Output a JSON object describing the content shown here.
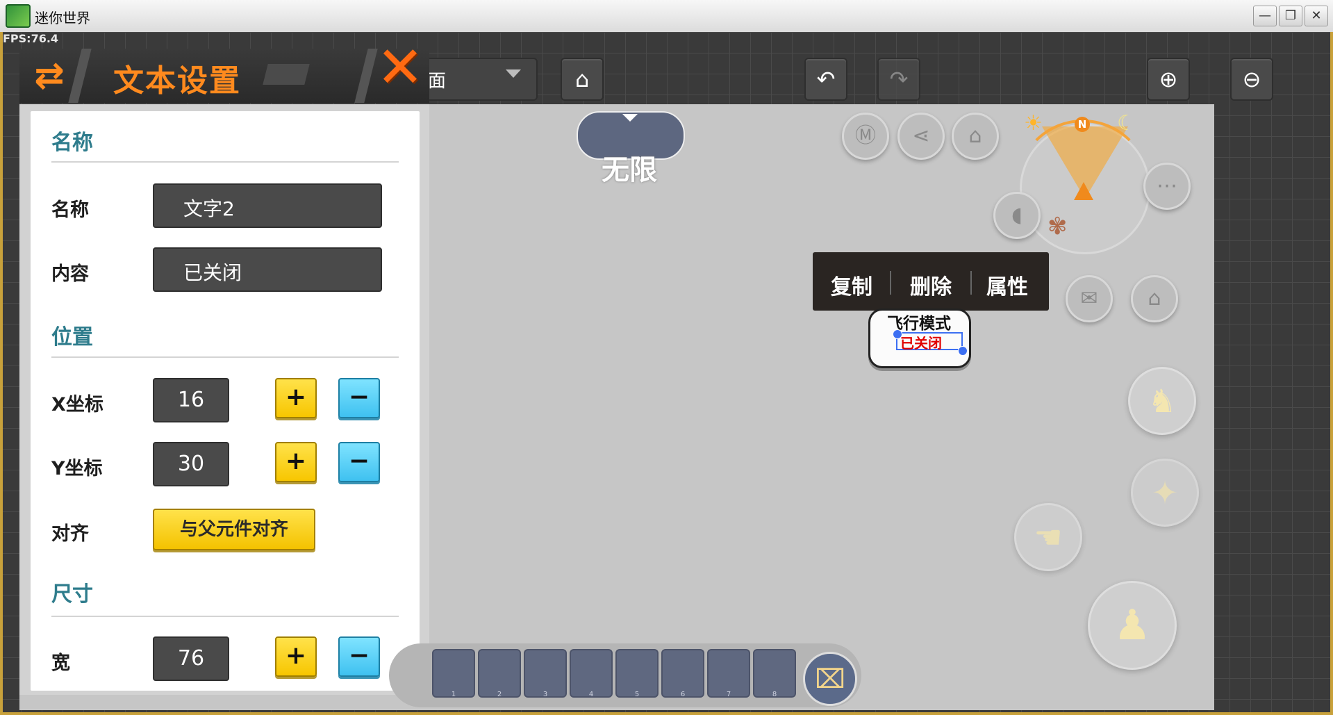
{
  "window": {
    "title": "迷你世界",
    "fps": "FPS:76.4",
    "minimize": "—",
    "restore": "❐",
    "close": "✕"
  },
  "toolbar": {
    "dropdown_text": "面",
    "icons": [
      "book-icon",
      "undo-icon",
      "redo-icon",
      "zoom-in-icon",
      "zoom-out-icon"
    ]
  },
  "panel": {
    "title": "文本设置",
    "swap_glyph": "⇄",
    "close_glyph": "✕",
    "sections": {
      "name": "名称",
      "position": "位置",
      "size": "尺寸"
    },
    "fields": {
      "name_label": "名称",
      "name_value": "文字2",
      "content_label": "内容",
      "content_value": "已关闭",
      "x_label": "X坐标",
      "x_value": "16",
      "y_label": "Y坐标",
      "y_value": "30",
      "align_label": "对齐",
      "align_button": "与父元件对齐",
      "width_label": "宽",
      "width_value": "76"
    },
    "plus": "+",
    "minus": "−"
  },
  "canvas": {
    "mode_text": "无限",
    "context_menu": [
      "复制",
      "删除",
      "属性"
    ],
    "widget_title": "飞行模式",
    "widget_value": "已关闭",
    "compass_north": "N"
  },
  "hotbar": {
    "slots": [
      "1",
      "2",
      "3",
      "4",
      "5",
      "6",
      "7",
      "8"
    ]
  }
}
